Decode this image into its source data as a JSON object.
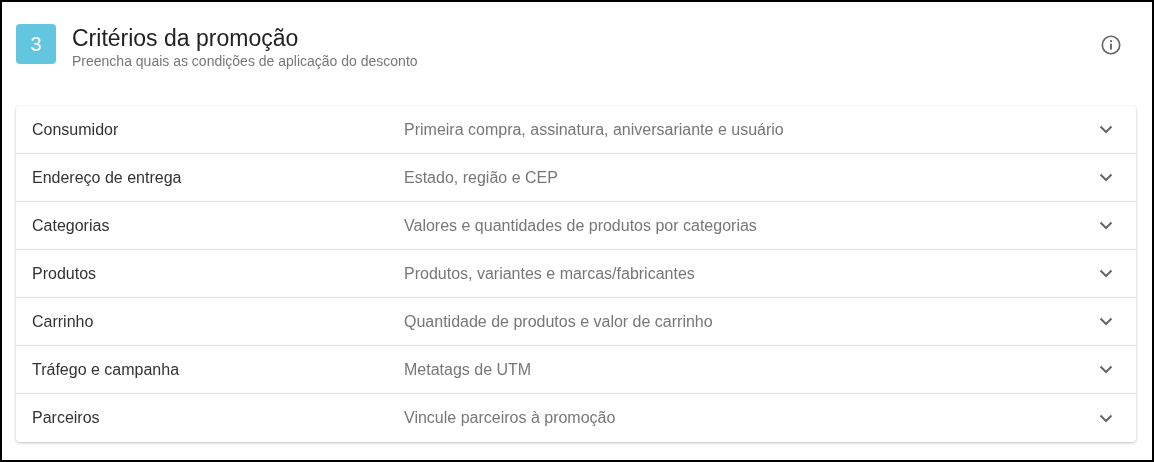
{
  "header": {
    "step": "3",
    "title": "Critérios da promoção",
    "subtitle": "Preencha quais as condições de aplicação do desconto"
  },
  "sections": [
    {
      "label": "Consumidor",
      "description": "Primeira compra, assinatura, aniversariante e usuário",
      "expanded": false
    },
    {
      "label": "Endereço de entrega",
      "description": "Estado, região e CEP",
      "expanded": false
    },
    {
      "label": "Categorias",
      "description": "Valores e quantidades de produtos por categorias",
      "expanded": false
    },
    {
      "label": "Produtos",
      "description": "Produtos, variantes e marcas/fabricantes",
      "expanded": false
    },
    {
      "label": "Carrinho",
      "description": "Quantidade de produtos e valor de carrinho",
      "expanded": false
    },
    {
      "label": "Tráfego e campanha",
      "description": "Metatags de UTM",
      "expanded": false
    },
    {
      "label": "Parceiros",
      "description": "Vincule parceiros à promoção",
      "expanded": false
    }
  ]
}
